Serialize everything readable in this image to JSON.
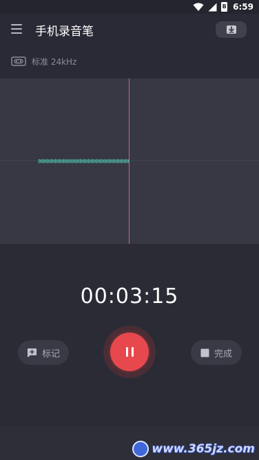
{
  "status_bar": {
    "time": "6:59",
    "battery_label": "B",
    "icons": [
      "wifi-icon",
      "signal-icon",
      "battery-icon"
    ]
  },
  "app_bar": {
    "title": "手机录音笔",
    "menu_icon": "hamburger-menu-icon",
    "save_icon": "save-download-icon"
  },
  "quality": {
    "icon": "cassette-tape-icon",
    "label": "标准 24kHz"
  },
  "recording": {
    "elapsed": "00:03:15",
    "state": "recording"
  },
  "controls": {
    "mark_label": "标记",
    "mark_icon": "add-marker-icon",
    "pause_icon": "pause-icon",
    "done_label": "完成",
    "done_icon": "stop-square-icon"
  },
  "watermark": {
    "text": "www.365jz.com"
  },
  "colors": {
    "accent_red": "#e6484d",
    "waveform_teal": "#4cc0ad",
    "playhead": "#c7677c",
    "background": "#2a2a36",
    "wave_panel": "#383844"
  }
}
